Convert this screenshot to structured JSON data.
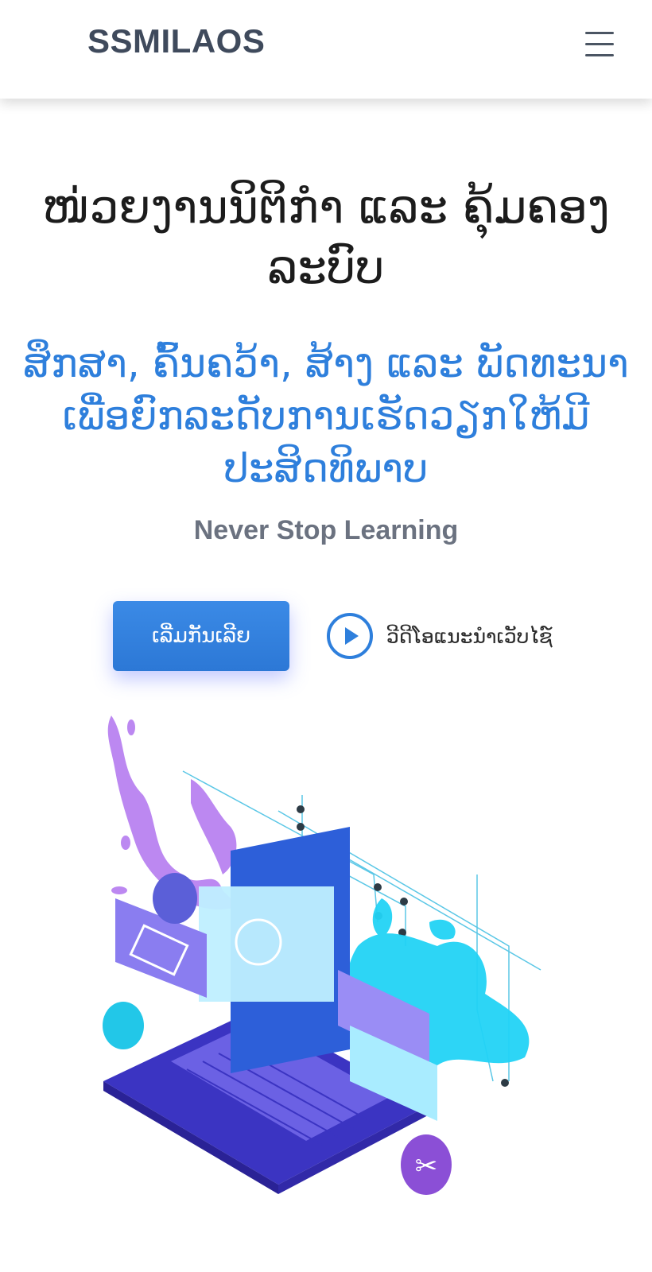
{
  "header": {
    "brand": "SSMILAOS",
    "menu_icon": "hamburger-menu-icon"
  },
  "hero": {
    "title": "ໜ່ວຍງານນິຕິກຳ ແລະ ຄຸ້ມຄອງລະບົບ",
    "subtitle": "ສຶກສາ, ຄົ້ນຄວ້າ, ສ້າງ ແລະ ພັດທະນາ ເພື່ອຍົກລະດັບການເຮັດວຽກໃຫ້ມີປະສິດທິພາບ",
    "tagline": "Never Stop Learning",
    "cta_label": "ເລີ່ມກັນເລີຍ",
    "video_label": "ວີດີໂອແນະນຳເວັບໄຊ໌",
    "video_icon": "play-circle-icon"
  },
  "colors": {
    "accent": "#2e7fdc",
    "brand_text": "#3f4a5c",
    "tagline": "#6b7280",
    "purple": "#b57cf0",
    "cyan": "#22d3f5",
    "laptop": "#3f37c9"
  }
}
